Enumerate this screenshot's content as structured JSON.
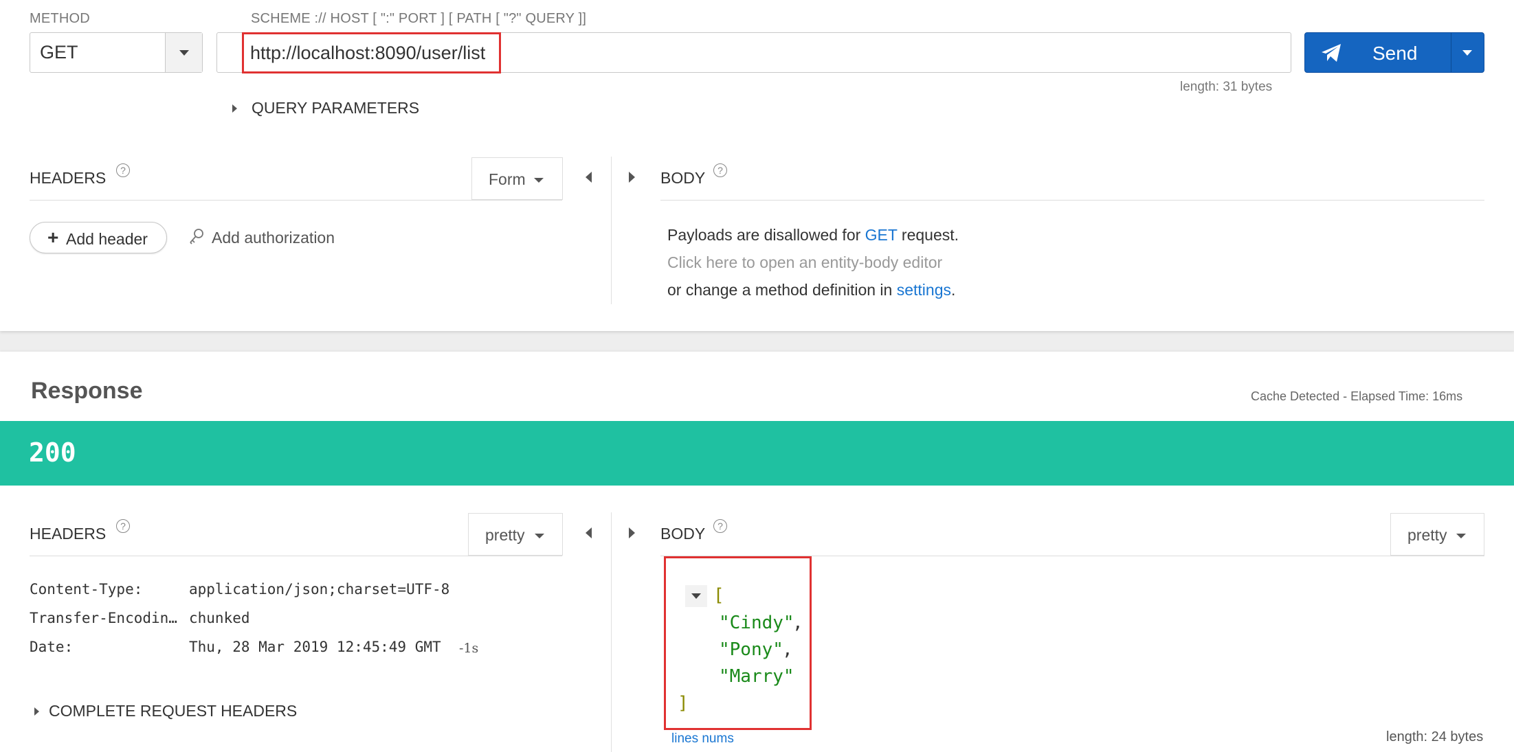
{
  "request": {
    "method_label": "METHOD",
    "method_value": "GET",
    "url_label": "SCHEME :// HOST [ \":\" PORT ] [ PATH [ \"?\" QUERY ]]",
    "url_value": "http://localhost:8090/user/list",
    "url_length": "length: 31 bytes",
    "send_label": "Send",
    "query_params_label": "QUERY PARAMETERS",
    "headers_label": "HEADERS",
    "headers_mode": "Form",
    "add_header_label": "Add header",
    "add_auth_label": "Add authorization",
    "body_label": "BODY",
    "body_msg_1_prefix": "Payloads are disallowed for ",
    "body_msg_1_method": "GET",
    "body_msg_1_suffix": " request.",
    "body_msg_2": "Click here to open an entity-body editor",
    "body_msg_3_prefix": "or change a method definition in ",
    "body_msg_3_link": "settings",
    "body_msg_3_suffix": "."
  },
  "response": {
    "title": "Response",
    "meta": "Cache Detected - Elapsed Time: 16ms",
    "status_code": "200",
    "headers_label": "HEADERS",
    "headers_mode": "pretty",
    "headers": [
      {
        "name": "Content-Type:",
        "value": "application/json;charset=UTF-8"
      },
      {
        "name": "Transfer-Encodin…",
        "value": "chunked"
      },
      {
        "name": "Date:",
        "value": "Thu, 28 Mar 2019 12:45:49 GMT",
        "extra": "-1s"
      }
    ],
    "complete_headers_label": "COMPLETE REQUEST HEADERS",
    "body_label": "BODY",
    "body_mode": "pretty",
    "body_json": {
      "open": "[",
      "items": [
        "\"Cindy\"",
        "\"Pony\"",
        "\"Marry\""
      ],
      "close": "]"
    },
    "lines_nums_label": "lines nums",
    "body_length": "length: 24 bytes"
  },
  "icons": {
    "send": "paper-plane-icon",
    "auth": "key-icon",
    "help": "question-circle-icon"
  },
  "colors": {
    "send_button": "#1565c0",
    "status_ok": "#1fc1a1",
    "highlight": "#e03131",
    "link": "#1976d2"
  }
}
